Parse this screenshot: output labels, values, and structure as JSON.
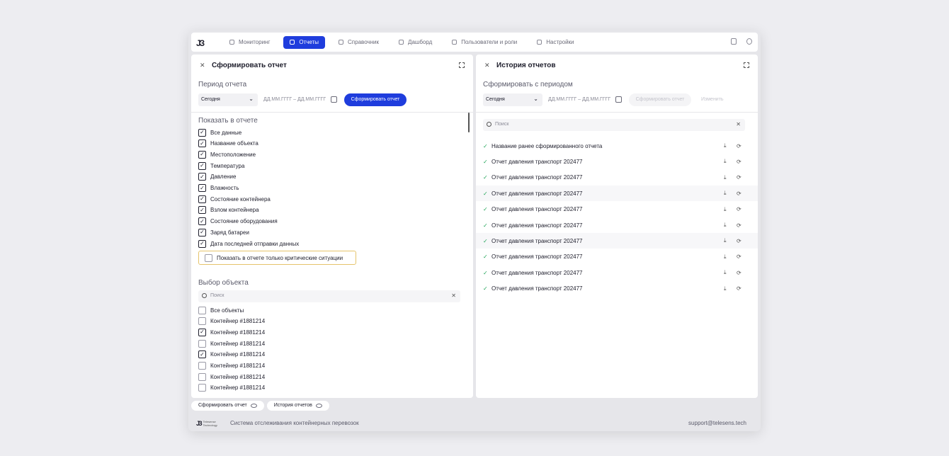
{
  "nav": {
    "logo": "ЈЗ",
    "items": [
      {
        "label": "Мониторинг",
        "active": false
      },
      {
        "label": "Отчеты",
        "active": true
      },
      {
        "label": "Справочник",
        "active": false
      },
      {
        "label": "Дашборд",
        "active": false
      },
      {
        "label": "Пользователи и роли",
        "active": false
      },
      {
        "label": "Настройки",
        "active": false
      }
    ],
    "active_color": "#1f3ddd"
  },
  "left_panel": {
    "title": "Сформировать отчет",
    "period_title": "Период отчета",
    "period_select": "Сегодня",
    "date_placeholder": "ДД.ММ.ГГГГ – ДД.ММ.ГГГГ",
    "submit_label": "Сформировать отчет",
    "show_title": "Показать в отчете",
    "fields": [
      {
        "label": "Все данные",
        "checked": true
      },
      {
        "label": "Название объекта",
        "checked": true
      },
      {
        "label": "Местоположение",
        "checked": true
      },
      {
        "label": "Температура",
        "checked": true
      },
      {
        "label": "Давление",
        "checked": true
      },
      {
        "label": "Влажность",
        "checked": true
      },
      {
        "label": "Состояние контейнера",
        "checked": true
      },
      {
        "label": "Взлом контейнера",
        "checked": true
      },
      {
        "label": "Состояние оборудования",
        "checked": true
      },
      {
        "label": "Заряд батареи",
        "checked": true
      },
      {
        "label": "Дата последней отправки данных",
        "checked": true
      }
    ],
    "critical_label": "Показать в отчете только критические ситуации",
    "object_title": "Выбор объекта",
    "search_placeholder": "Поиск",
    "objects": [
      {
        "label": "Все объекты",
        "checked": false
      },
      {
        "label": "Контейнер #1881214",
        "checked": false
      },
      {
        "label": "Контейнер #1881214",
        "checked": true
      },
      {
        "label": "Контейнер #1881214",
        "checked": false
      },
      {
        "label": "Контейнер #1881214",
        "checked": true
      },
      {
        "label": "Контейнер #1881214",
        "checked": false
      },
      {
        "label": "Контейнер #1881214",
        "checked": false
      },
      {
        "label": "Контейнер #1881214",
        "checked": false
      }
    ]
  },
  "right_panel": {
    "title": "История отчетов",
    "period_title": "Сформировать с периодом",
    "period_select": "Сегодня",
    "date_placeholder": "ДД.ММ.ГГГГ – ДД.ММ.ГГГГ",
    "submit_label": "Сформировать отчет",
    "edit_label": "Изменить",
    "search_placeholder": "Поиск",
    "reports": [
      "Название ранее сформированного отчета",
      "Отчет давления транспорт 202477",
      "Отчет давления транспорт 202477",
      "Отчет давления транспорт 202477",
      "Отчет давления транспорт 202477",
      "Отчет давления транспорт 202477",
      "Отчет давления транспорт 202477",
      "Отчет давления транспорт 202477",
      "Отчет давления транспорт 202477",
      "Отчет давления транспорт 202477"
    ]
  },
  "bottom_tabs": [
    "Сформировать отчет",
    "История отчетов"
  ],
  "footer": {
    "logo_text": "Telesense Technology",
    "system_text": "Система отслеживания контейнерных перевозок",
    "email": "support@telesens.tech"
  }
}
